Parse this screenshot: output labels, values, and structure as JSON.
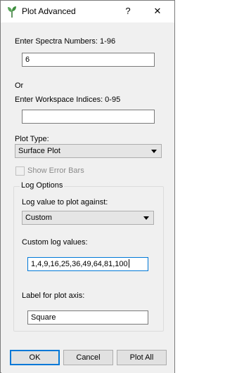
{
  "window": {
    "title": "Plot Advanced",
    "help_label": "?",
    "close_label": "✕"
  },
  "spectra": {
    "label": "Enter Spectra Numbers: 1-96",
    "value": "6"
  },
  "or_label": "Or",
  "indices": {
    "label": "Enter Workspace Indices: 0-95",
    "value": ""
  },
  "plot_type": {
    "label": "Plot Type:",
    "selected": "Surface Plot"
  },
  "error_bars": {
    "label": "Show Error Bars",
    "checked": false,
    "enabled": false
  },
  "log_options": {
    "title": "Log Options",
    "log_value_label": "Log value to plot against:",
    "log_value_selected": "Custom",
    "custom_values_label": "Custom log values:",
    "custom_values": "1,4,9,16,25,36,49,64,81,100",
    "axis_label_label": "Label for plot axis:",
    "axis_label_value": "Square"
  },
  "buttons": {
    "ok": "OK",
    "cancel": "Cancel",
    "plot_all": "Plot All"
  }
}
